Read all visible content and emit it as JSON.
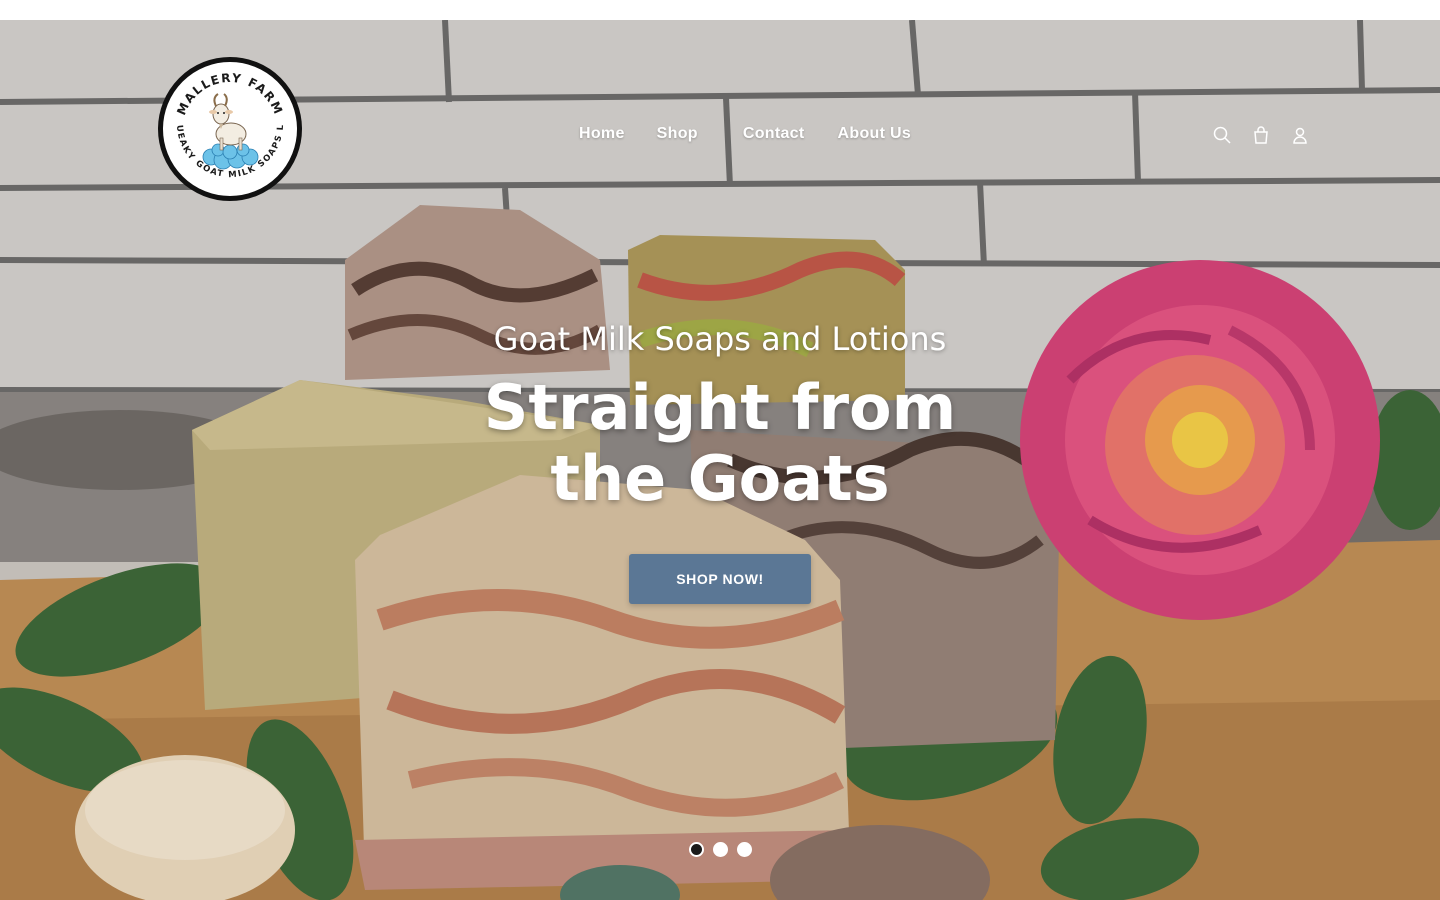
{
  "brand": {
    "name_arc_top": "MALLERY FARM",
    "name_arc_bottom": "SQUEAKY GOAT MILK SOAPS LLC",
    "logo_icon": "goat-on-bubbles"
  },
  "nav": {
    "items": [
      {
        "label": "Home"
      },
      {
        "label": "Shop"
      },
      {
        "label": "Contact"
      },
      {
        "label": "About Us"
      }
    ]
  },
  "header_icons": [
    "search-icon",
    "cart-icon",
    "account-icon"
  ],
  "hero": {
    "subtitle": "Goat Milk Soaps and Lotions",
    "title": "Straight from the Goats",
    "cta_label": "SHOP NOW!",
    "slides_total": 3,
    "active_slide": 1
  },
  "colors": {
    "cta_background": "#5b7795",
    "text": "#ffffff"
  }
}
